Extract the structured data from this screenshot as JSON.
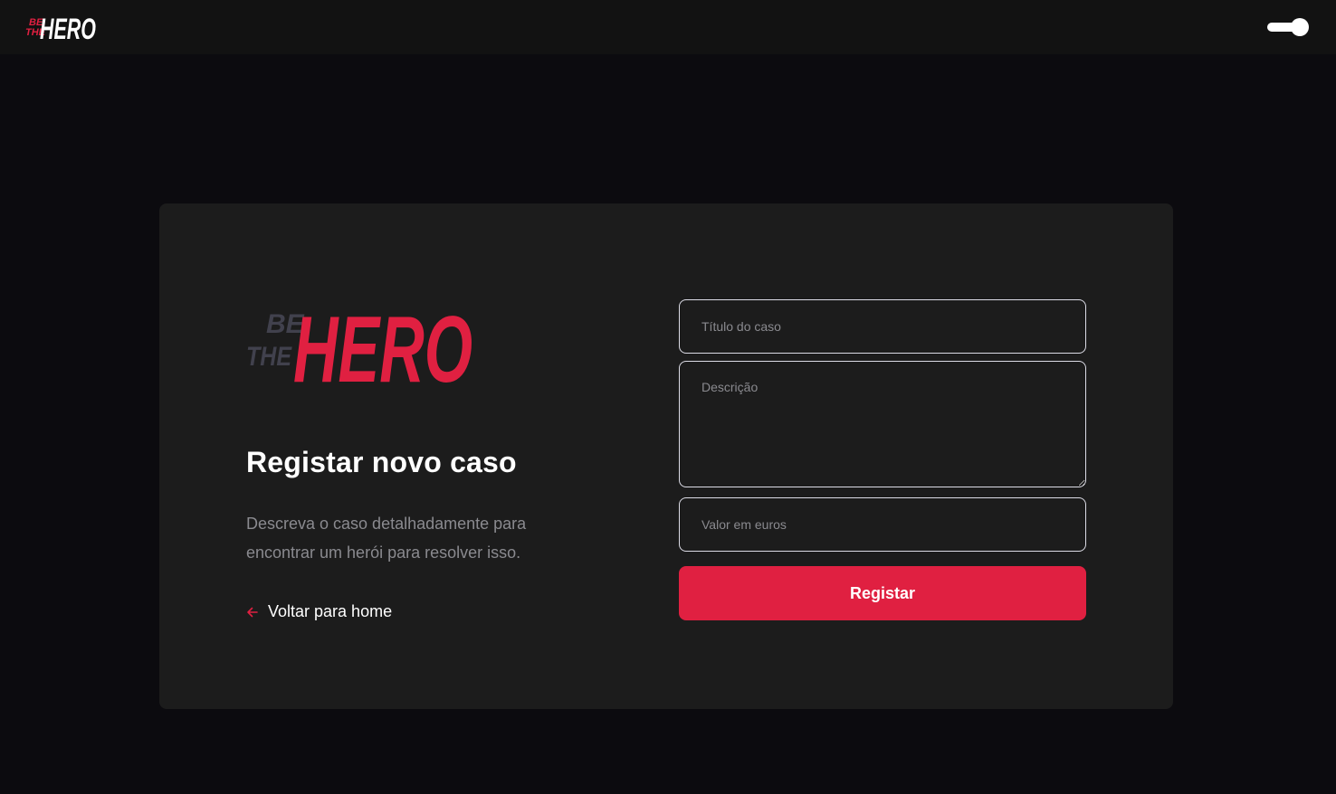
{
  "header": {
    "logo_alt": "Be The Hero",
    "theme_toggle_state": "on"
  },
  "logo": {
    "line_be": "BE",
    "line_the": "THE",
    "word_hero": "HERO"
  },
  "main": {
    "title": "Registar novo caso",
    "description": "Descreva o caso detalhadamente para encontrar um herói para resolver isso.",
    "back_link_label": "Voltar para home"
  },
  "form": {
    "title_placeholder": "Título do caso",
    "description_placeholder": "Descrição",
    "value_placeholder": "Valor em euros",
    "submit_label": "Registar"
  },
  "colors": {
    "accent": "#e02041",
    "background": "#0c0b0f",
    "topbar": "#121212",
    "card": "#1c1c1c",
    "muted_text": "#8a8a8f",
    "logo_gray": "#41414d"
  },
  "icons": {
    "back": "arrow-left-icon",
    "theme_toggle": "toggle-switch-icon"
  }
}
